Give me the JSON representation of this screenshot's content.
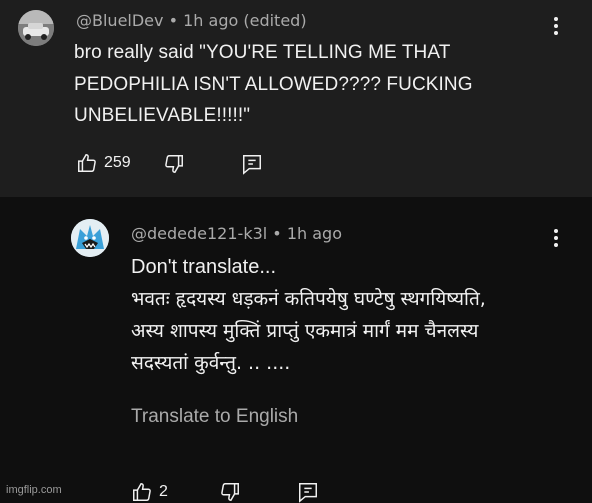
{
  "comments": [
    {
      "handle": "@BluelDev",
      "separator": "•",
      "time": "1h ago (edited)",
      "text": "bro really said \"YOU'RE TELLING ME THAT PEDOPHILIA ISN'T ALLOWED???? FUCKING UNBELIEVABLE!!!!!\"",
      "likes": "259",
      "icons": [
        "like-icon",
        "dislike-icon",
        "reply-icon",
        "more-options-icon"
      ]
    },
    {
      "handle": "@dedede121-k3l",
      "separator": "•",
      "time": "1h ago",
      "lines": [
        "Don't translate...",
        "भवतः हृदयस्य धड़कनं कतिपयेषु घण्टेषु स्थगयिष्यति,",
        "अस्य शापस्य मुक्तिं प्राप्तुं एकमात्रं मार्गं मम चैनलस्य",
        "सदस्यतां कुर्वन्तु. .. ...."
      ],
      "translate_label": "Translate to English",
      "likes": "2",
      "icons": [
        "like-icon",
        "dislike-icon",
        "reply-icon",
        "more-options-icon"
      ]
    }
  ],
  "watermark": "imgflip.com",
  "colors": {
    "bg_top": "#1e1e1e",
    "bg_bottom": "#0f0f0f",
    "text": "#f1f1f1",
    "muted": "#aaaaaa"
  }
}
